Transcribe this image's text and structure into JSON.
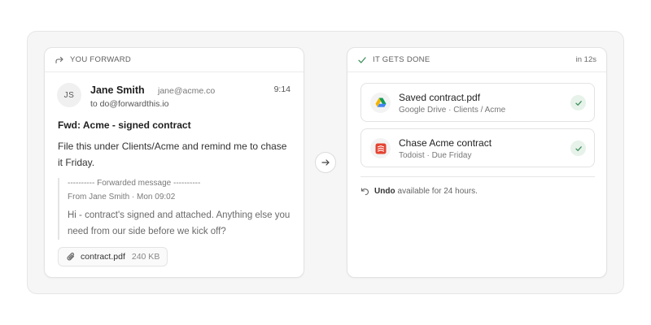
{
  "left_card": {
    "header": {
      "label": "YOU FORWARD",
      "icon": "forward-arrow-icon"
    },
    "email": {
      "avatar_initials": "JS",
      "sender_name": "Jane Smith",
      "sender_email": "jane@acme.co",
      "to_line": "to do@forwardthis.io",
      "time": "9:14",
      "subject": "Fwd: Acme - signed contract",
      "body": "File this under Clients/Acme and remind me to chase it Friday.",
      "forwarded": {
        "title": "---------- Forwarded message ----------",
        "from": "From Jane Smith · Mon 09:02",
        "body": "Hi - contract's signed and attached. Anything else you need from our side before we kick off?"
      },
      "attachment": {
        "name": "contract.pdf",
        "size": "240 KB",
        "icon": "paperclip-icon"
      }
    }
  },
  "middle": {
    "icon": "arrow-right-icon"
  },
  "right_card": {
    "header": {
      "label": "IT GETS DONE",
      "meta": "in 12s",
      "icon": "check-icon"
    },
    "tasks": [
      {
        "title": "Saved contract.pdf",
        "subtitle": "Google Drive · Clients / Acme",
        "icon": "google-drive-icon",
        "status": "done"
      },
      {
        "title": "Chase Acme contract",
        "subtitle": "Todoist · Due Friday",
        "icon": "todoist-icon",
        "status": "done"
      }
    ],
    "undo": {
      "label": "Undo",
      "text": "available for 24 hours.",
      "icon": "undo-icon"
    }
  },
  "colors": {
    "background": "#f6f6f6",
    "card": "#ffffff",
    "check_bg": "#e6f2ea",
    "check_fg": "#3f8f5c",
    "todoist_red": "#e44332",
    "drive_blue": "#4285f4",
    "drive_green": "#0f9d58",
    "drive_yellow": "#f4b400"
  }
}
